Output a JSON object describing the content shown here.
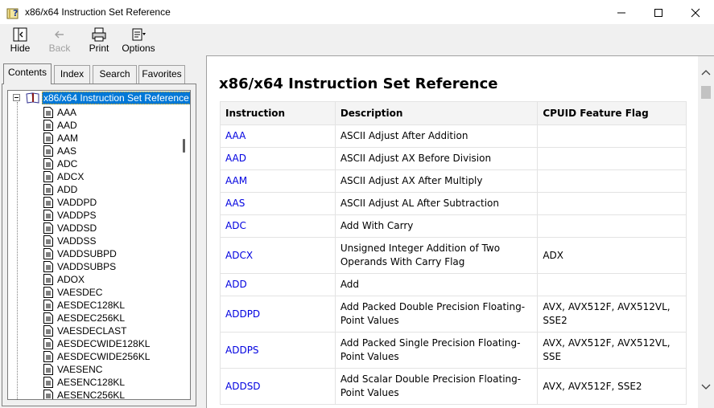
{
  "window": {
    "title": "x86/x64 Instruction Set Reference"
  },
  "toolbar": {
    "hide_label": "Hide",
    "back_label": "Back",
    "print_label": "Print",
    "options_label": "Options"
  },
  "tabs": [
    {
      "label": "Contents",
      "active": true
    },
    {
      "label": "Index",
      "active": false
    },
    {
      "label": "Search",
      "active": false
    },
    {
      "label": "Favorites",
      "active": false
    }
  ],
  "tree": {
    "root_label": "x86/x64 Instruction Set Reference",
    "items": [
      "AAA",
      "AAD",
      "AAM",
      "AAS",
      "ADC",
      "ADCX",
      "ADD",
      "VADDPD",
      "VADDPS",
      "VADDSD",
      "VADDSS",
      "VADDSUBPD",
      "VADDSUBPS",
      "ADOX",
      "VAESDEC",
      "AESDEC128KL",
      "AESDEC256KL",
      "VAESDECLAST",
      "AESDECWIDE128KL",
      "AESDECWIDE256KL",
      "VAESENC",
      "AESENC128KL",
      "AESENC256KL"
    ]
  },
  "content": {
    "title": "x86/x64 Instruction Set Reference",
    "columns": [
      "Instruction",
      "Description",
      "CPUID Feature Flag"
    ],
    "rows": [
      {
        "instruction": "AAA",
        "description": "ASCII Adjust After Addition",
        "cpuid": ""
      },
      {
        "instruction": "AAD",
        "description": "ASCII Adjust AX Before Division",
        "cpuid": ""
      },
      {
        "instruction": "AAM",
        "description": "ASCII Adjust AX After Multiply",
        "cpuid": ""
      },
      {
        "instruction": "AAS",
        "description": "ASCII Adjust AL After Subtraction",
        "cpuid": ""
      },
      {
        "instruction": "ADC",
        "description": "Add With Carry",
        "cpuid": ""
      },
      {
        "instruction": "ADCX",
        "description": "Unsigned Integer Addition of Two Operands With Carry Flag",
        "cpuid": "ADX"
      },
      {
        "instruction": "ADD",
        "description": "Add",
        "cpuid": ""
      },
      {
        "instruction": "ADDPD",
        "description": "Add Packed Double Precision Floating-Point Values",
        "cpuid": "AVX, AVX512F, AVX512VL, SSE2"
      },
      {
        "instruction": "ADDPS",
        "description": "Add Packed Single Precision Floating-Point Values",
        "cpuid": "AVX, AVX512F, AVX512VL, SSE"
      },
      {
        "instruction": "ADDSD",
        "description": "Add Scalar Double Precision Floating-Point Values",
        "cpuid": "AVX, AVX512F, SSE2"
      }
    ]
  },
  "colors": {
    "link": "#0000e0",
    "selection": "#0078d7",
    "header_bg": "#f4f4f4"
  }
}
